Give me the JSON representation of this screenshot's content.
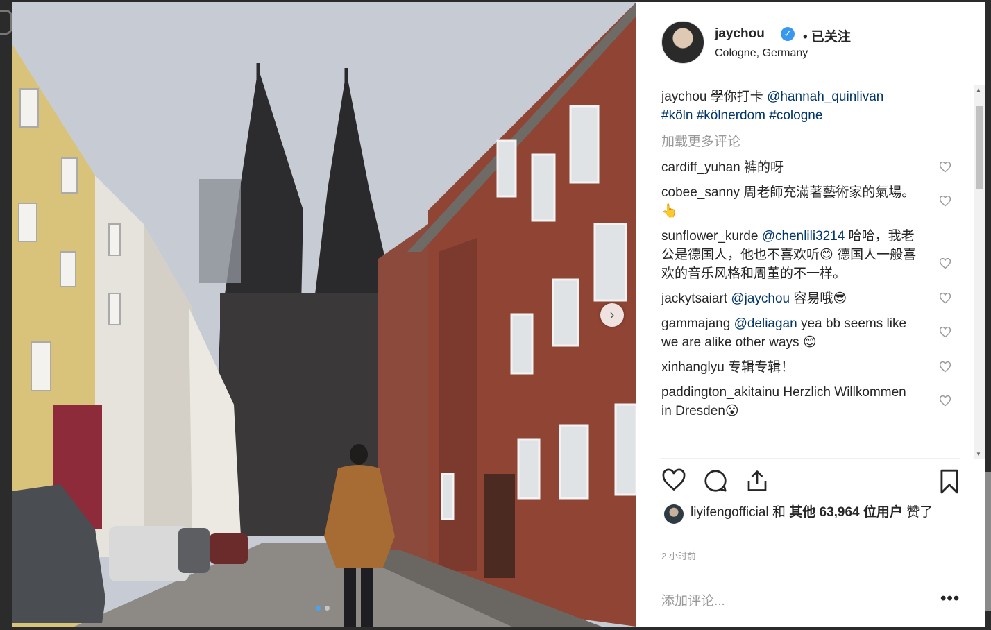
{
  "post": {
    "username": "jaychou",
    "follow_status": "• 已关注",
    "location": "Cologne, Germany",
    "caption": {
      "user": "jaychou",
      "text": "學你打卡",
      "mention": "@hannah_quinlivan",
      "tag1": "#köln",
      "tag2": "#kölnerdom",
      "tag3": "#cologne"
    },
    "load_more": "加载更多评论",
    "comments": [
      {
        "user": "cardiff_yuhan",
        "mention": "",
        "text": "裤的呀"
      },
      {
        "user": "cobee_sanny",
        "mention": "",
        "text": "周老師充滿著藝術家的氣場。👆"
      },
      {
        "user": "sunflower_kurde",
        "mention": "@chenlili3214",
        "text": "哈哈，我老公是德国人，他也不喜欢听😊 德国人一般喜欢的音乐风格和周董的不一样。"
      },
      {
        "user": "jackytsaiart",
        "mention": "@jaychou",
        "text": "容易哦😎"
      },
      {
        "user": "gammajang",
        "mention": "@deliagan",
        "text": "yea bb seems like we are alike other ways 😊"
      },
      {
        "user": "xinhanglyu",
        "mention": "",
        "text": "专辑专辑！"
      },
      {
        "user": "paddington_akitainu",
        "mention": "",
        "text": "Herzlich Willkommen in Dresden😮"
      }
    ],
    "likes": {
      "user": "liyifengofficial",
      "joiner": "和",
      "others": "其他 63,964 位用户",
      "suffix": "赞了"
    },
    "time": "2 小时前",
    "add_comment_placeholder": "添加评论...",
    "more_options": "•••"
  },
  "icons": {
    "like": "heart-icon",
    "comment": "comment-icon",
    "share": "share-icon",
    "save": "bookmark-icon",
    "next": "chevron-right-icon"
  },
  "colors": {
    "link": "#003569",
    "verified": "#3897f0",
    "carousel_active": "#4ba3f0"
  }
}
